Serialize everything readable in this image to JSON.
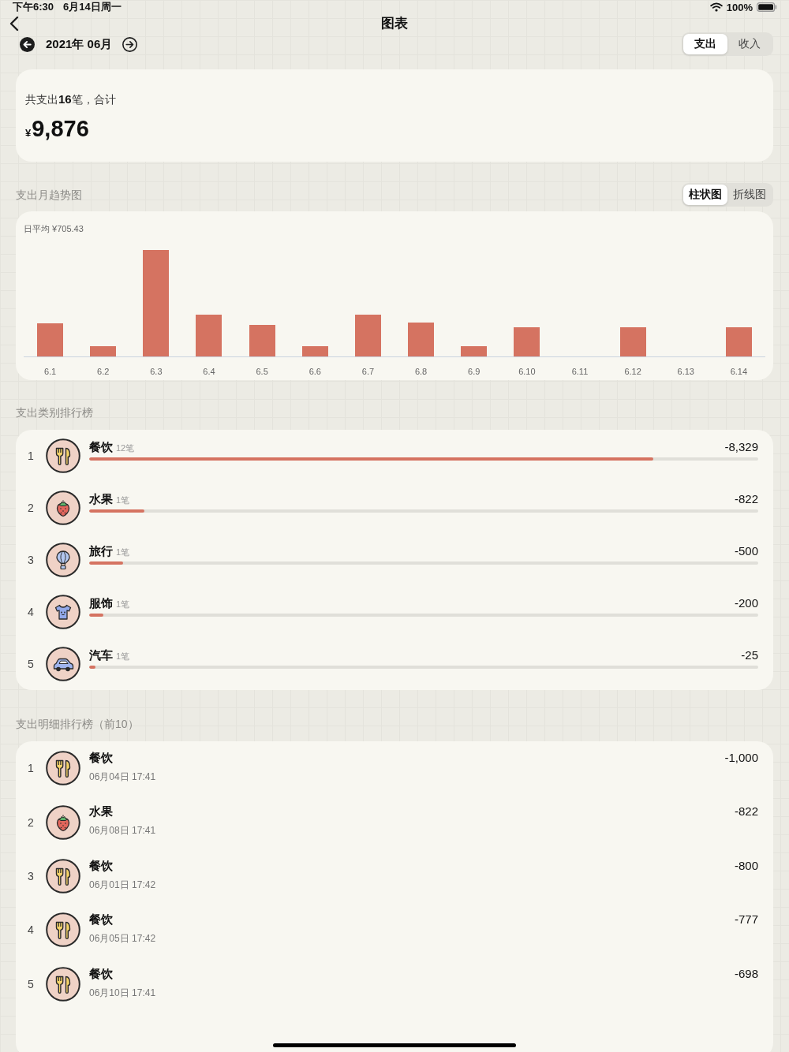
{
  "status_bar": {
    "time": "下午6:30",
    "date": "6月14日周一",
    "battery": "100%"
  },
  "nav": {
    "title": "图表"
  },
  "period": {
    "label": "2021年 06月",
    "type_tabs": [
      {
        "label": "支出",
        "selected": true
      },
      {
        "label": "收入",
        "selected": false
      }
    ]
  },
  "summary": {
    "caption": "共支出**16**笔，合计",
    "currency": "¥",
    "total": "9,876"
  },
  "trend": {
    "title": "支出月趋势图",
    "chart_tabs": [
      {
        "label": "柱状图",
        "selected": true
      },
      {
        "label": "折线图",
        "selected": false
      }
    ],
    "average": "日平均 ¥705.43",
    "x_labels": [
      "6.1",
      "6.2",
      "6.3",
      "6.4",
      "6.5",
      "6.6",
      "6.7",
      "6.8",
      "6.9",
      "6.10",
      "6.11",
      "6.12",
      "6.13",
      "6.14"
    ]
  },
  "category_ranking": {
    "title": "支出类别排行榜",
    "items": [
      {
        "rank": "1",
        "kind": "food",
        "name": "餐饮",
        "count": "12笔",
        "amount": "-8,329",
        "level": 0.843
      },
      {
        "rank": "2",
        "kind": "fruit",
        "name": "水果",
        "count": "1笔",
        "amount": "-822",
        "level": 0.083
      },
      {
        "rank": "3",
        "kind": "travel",
        "name": "旅行",
        "count": "1笔",
        "amount": "-500",
        "level": 0.051
      },
      {
        "rank": "4",
        "kind": "clothing",
        "name": "服饰",
        "count": "1笔",
        "amount": "-200",
        "level": 0.021
      },
      {
        "rank": "5",
        "kind": "car",
        "name": "汽车",
        "count": "1笔",
        "amount": "-25",
        "level": 0.01
      }
    ]
  },
  "detail_ranking": {
    "title": "支出明细排行榜（前10）",
    "items": [
      {
        "rank": "1",
        "kind": "food",
        "name": "餐饮",
        "time": "06月04日 17:41",
        "amount": "-1,000"
      },
      {
        "rank": "2",
        "kind": "fruit",
        "name": "水果",
        "time": "06月08日 17:41",
        "amount": "-822"
      },
      {
        "rank": "3",
        "kind": "food",
        "name": "餐饮",
        "time": "06月01日 17:42",
        "amount": "-800"
      },
      {
        "rank": "4",
        "kind": "food",
        "name": "餐饮",
        "time": "06月05日 17:42",
        "amount": "-777"
      },
      {
        "rank": "5",
        "kind": "food",
        "name": "餐饮",
        "time": "06月10日 17:41",
        "amount": "-698"
      }
    ]
  }
}
